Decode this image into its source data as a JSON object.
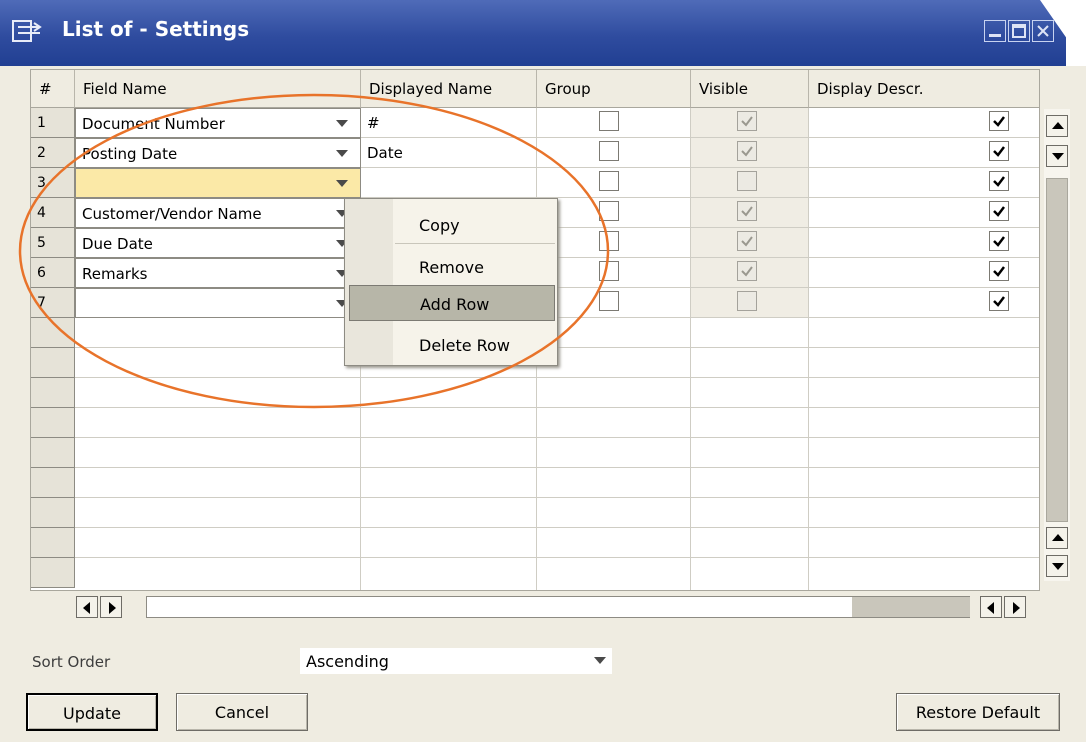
{
  "window": {
    "title": "List of - Settings",
    "title_bar_color": "#2f4c9f",
    "controls": [
      "minimize-icon",
      "maximize-icon",
      "close-icon"
    ]
  },
  "grid": {
    "columns": [
      "#",
      "Field Name",
      "Displayed Name",
      "Group",
      "Visible",
      "Display Descr."
    ],
    "rows": [
      {
        "num": "1",
        "field": "Document Number",
        "displayed": "#",
        "group": false,
        "visible": true,
        "descr": true
      },
      {
        "num": "2",
        "field": "Posting Date",
        "displayed": "Date",
        "group": false,
        "visible": true,
        "descr": true
      },
      {
        "num": "3",
        "field": "",
        "displayed": "",
        "group": false,
        "visible": false,
        "descr": true
      },
      {
        "num": "4",
        "field": "Customer/Vendor Name",
        "displayed": "",
        "group": false,
        "visible": true,
        "descr": true
      },
      {
        "num": "5",
        "field": "Due Date",
        "displayed": "",
        "group": false,
        "visible": true,
        "descr": true
      },
      {
        "num": "6",
        "field": "Remarks",
        "displayed": "",
        "group": false,
        "visible": true,
        "descr": true
      },
      {
        "num": "7",
        "field": "",
        "displayed": "",
        "group": false,
        "visible": false,
        "descr": true
      }
    ],
    "selected_row_color": "#fbe9a7"
  },
  "context_menu": {
    "items": [
      {
        "label": "Copy",
        "mnemonic": "o"
      },
      {
        "label": "Remove",
        "mnemonic": "R"
      },
      {
        "label": "Add Row",
        "mnemonic": "w",
        "highlighted": true
      },
      {
        "label": "Delete Row",
        "mnemonic": "t"
      }
    ]
  },
  "sort": {
    "label": "Sort Order",
    "value": "Ascending"
  },
  "buttons": {
    "update": "Update",
    "cancel": "Cancel",
    "restore": "Restore Default"
  },
  "annotation": {
    "ellipse_color": "#e8732a"
  }
}
